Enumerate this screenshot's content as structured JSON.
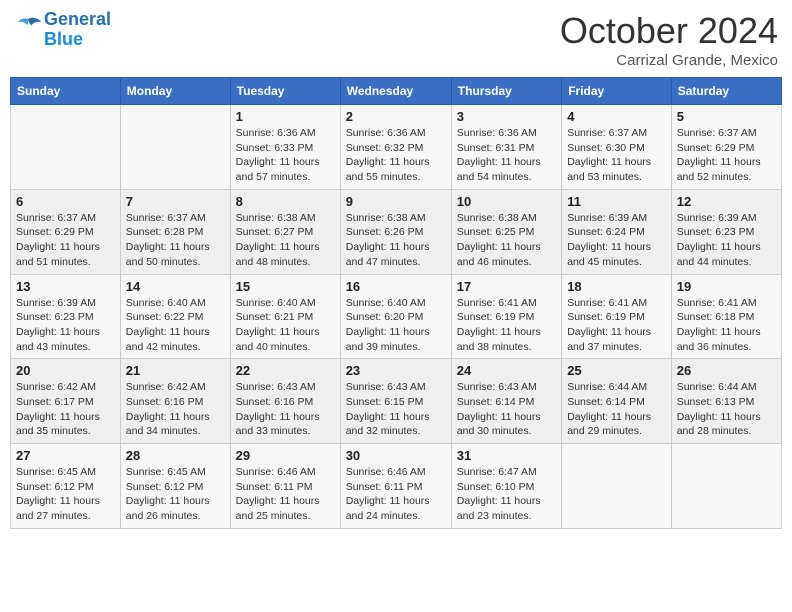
{
  "header": {
    "logo_general": "General",
    "logo_blue": "Blue",
    "month": "October 2024",
    "location": "Carrizal Grande, Mexico"
  },
  "weekdays": [
    "Sunday",
    "Monday",
    "Tuesday",
    "Wednesday",
    "Thursday",
    "Friday",
    "Saturday"
  ],
  "weeks": [
    [
      {
        "day": "",
        "sunrise": "",
        "sunset": "",
        "daylight": ""
      },
      {
        "day": "",
        "sunrise": "",
        "sunset": "",
        "daylight": ""
      },
      {
        "day": "1",
        "sunrise": "Sunrise: 6:36 AM",
        "sunset": "Sunset: 6:33 PM",
        "daylight": "Daylight: 11 hours and 57 minutes."
      },
      {
        "day": "2",
        "sunrise": "Sunrise: 6:36 AM",
        "sunset": "Sunset: 6:32 PM",
        "daylight": "Daylight: 11 hours and 55 minutes."
      },
      {
        "day": "3",
        "sunrise": "Sunrise: 6:36 AM",
        "sunset": "Sunset: 6:31 PM",
        "daylight": "Daylight: 11 hours and 54 minutes."
      },
      {
        "day": "4",
        "sunrise": "Sunrise: 6:37 AM",
        "sunset": "Sunset: 6:30 PM",
        "daylight": "Daylight: 11 hours and 53 minutes."
      },
      {
        "day": "5",
        "sunrise": "Sunrise: 6:37 AM",
        "sunset": "Sunset: 6:29 PM",
        "daylight": "Daylight: 11 hours and 52 minutes."
      }
    ],
    [
      {
        "day": "6",
        "sunrise": "Sunrise: 6:37 AM",
        "sunset": "Sunset: 6:29 PM",
        "daylight": "Daylight: 11 hours and 51 minutes."
      },
      {
        "day": "7",
        "sunrise": "Sunrise: 6:37 AM",
        "sunset": "Sunset: 6:28 PM",
        "daylight": "Daylight: 11 hours and 50 minutes."
      },
      {
        "day": "8",
        "sunrise": "Sunrise: 6:38 AM",
        "sunset": "Sunset: 6:27 PM",
        "daylight": "Daylight: 11 hours and 48 minutes."
      },
      {
        "day": "9",
        "sunrise": "Sunrise: 6:38 AM",
        "sunset": "Sunset: 6:26 PM",
        "daylight": "Daylight: 11 hours and 47 minutes."
      },
      {
        "day": "10",
        "sunrise": "Sunrise: 6:38 AM",
        "sunset": "Sunset: 6:25 PM",
        "daylight": "Daylight: 11 hours and 46 minutes."
      },
      {
        "day": "11",
        "sunrise": "Sunrise: 6:39 AM",
        "sunset": "Sunset: 6:24 PM",
        "daylight": "Daylight: 11 hours and 45 minutes."
      },
      {
        "day": "12",
        "sunrise": "Sunrise: 6:39 AM",
        "sunset": "Sunset: 6:23 PM",
        "daylight": "Daylight: 11 hours and 44 minutes."
      }
    ],
    [
      {
        "day": "13",
        "sunrise": "Sunrise: 6:39 AM",
        "sunset": "Sunset: 6:23 PM",
        "daylight": "Daylight: 11 hours and 43 minutes."
      },
      {
        "day": "14",
        "sunrise": "Sunrise: 6:40 AM",
        "sunset": "Sunset: 6:22 PM",
        "daylight": "Daylight: 11 hours and 42 minutes."
      },
      {
        "day": "15",
        "sunrise": "Sunrise: 6:40 AM",
        "sunset": "Sunset: 6:21 PM",
        "daylight": "Daylight: 11 hours and 40 minutes."
      },
      {
        "day": "16",
        "sunrise": "Sunrise: 6:40 AM",
        "sunset": "Sunset: 6:20 PM",
        "daylight": "Daylight: 11 hours and 39 minutes."
      },
      {
        "day": "17",
        "sunrise": "Sunrise: 6:41 AM",
        "sunset": "Sunset: 6:19 PM",
        "daylight": "Daylight: 11 hours and 38 minutes."
      },
      {
        "day": "18",
        "sunrise": "Sunrise: 6:41 AM",
        "sunset": "Sunset: 6:19 PM",
        "daylight": "Daylight: 11 hours and 37 minutes."
      },
      {
        "day": "19",
        "sunrise": "Sunrise: 6:41 AM",
        "sunset": "Sunset: 6:18 PM",
        "daylight": "Daylight: 11 hours and 36 minutes."
      }
    ],
    [
      {
        "day": "20",
        "sunrise": "Sunrise: 6:42 AM",
        "sunset": "Sunset: 6:17 PM",
        "daylight": "Daylight: 11 hours and 35 minutes."
      },
      {
        "day": "21",
        "sunrise": "Sunrise: 6:42 AM",
        "sunset": "Sunset: 6:16 PM",
        "daylight": "Daylight: 11 hours and 34 minutes."
      },
      {
        "day": "22",
        "sunrise": "Sunrise: 6:43 AM",
        "sunset": "Sunset: 6:16 PM",
        "daylight": "Daylight: 11 hours and 33 minutes."
      },
      {
        "day": "23",
        "sunrise": "Sunrise: 6:43 AM",
        "sunset": "Sunset: 6:15 PM",
        "daylight": "Daylight: 11 hours and 32 minutes."
      },
      {
        "day": "24",
        "sunrise": "Sunrise: 6:43 AM",
        "sunset": "Sunset: 6:14 PM",
        "daylight": "Daylight: 11 hours and 30 minutes."
      },
      {
        "day": "25",
        "sunrise": "Sunrise: 6:44 AM",
        "sunset": "Sunset: 6:14 PM",
        "daylight": "Daylight: 11 hours and 29 minutes."
      },
      {
        "day": "26",
        "sunrise": "Sunrise: 6:44 AM",
        "sunset": "Sunset: 6:13 PM",
        "daylight": "Daylight: 11 hours and 28 minutes."
      }
    ],
    [
      {
        "day": "27",
        "sunrise": "Sunrise: 6:45 AM",
        "sunset": "Sunset: 6:12 PM",
        "daylight": "Daylight: 11 hours and 27 minutes."
      },
      {
        "day": "28",
        "sunrise": "Sunrise: 6:45 AM",
        "sunset": "Sunset: 6:12 PM",
        "daylight": "Daylight: 11 hours and 26 minutes."
      },
      {
        "day": "29",
        "sunrise": "Sunrise: 6:46 AM",
        "sunset": "Sunset: 6:11 PM",
        "daylight": "Daylight: 11 hours and 25 minutes."
      },
      {
        "day": "30",
        "sunrise": "Sunrise: 6:46 AM",
        "sunset": "Sunset: 6:11 PM",
        "daylight": "Daylight: 11 hours and 24 minutes."
      },
      {
        "day": "31",
        "sunrise": "Sunrise: 6:47 AM",
        "sunset": "Sunset: 6:10 PM",
        "daylight": "Daylight: 11 hours and 23 minutes."
      },
      {
        "day": "",
        "sunrise": "",
        "sunset": "",
        "daylight": ""
      },
      {
        "day": "",
        "sunrise": "",
        "sunset": "",
        "daylight": ""
      }
    ]
  ]
}
